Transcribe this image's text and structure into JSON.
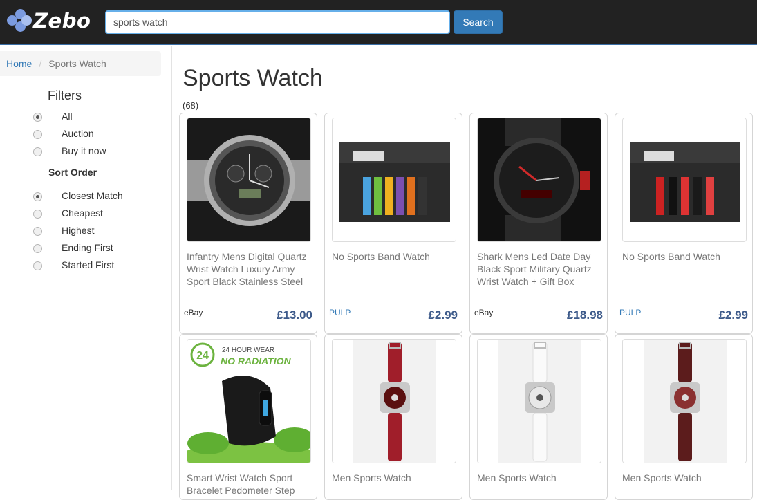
{
  "header": {
    "logo_text": "Zebo",
    "search_value": "sports watch",
    "search_button": "Search"
  },
  "breadcrumb": {
    "home": "Home",
    "separator": "/",
    "current": "Sports Watch"
  },
  "filters": {
    "title": "Filters",
    "options": [
      {
        "label": "All",
        "selected": true
      },
      {
        "label": "Auction",
        "selected": false
      },
      {
        "label": "Buy it now",
        "selected": false
      }
    ]
  },
  "sort": {
    "title": "Sort Order",
    "options": [
      {
        "label": "Closest Match",
        "selected": true
      },
      {
        "label": "Cheapest",
        "selected": false
      },
      {
        "label": "Highest",
        "selected": false
      },
      {
        "label": "Ending First",
        "selected": false
      },
      {
        "label": "Started First",
        "selected": false
      }
    ]
  },
  "main": {
    "title": "Sports Watch",
    "count": "(68)"
  },
  "products": [
    {
      "title": "Infantry Mens Digital Quartz Wrist Watch Luxury Army Sport Black Stainless Steel",
      "source": "eBay",
      "price": "£13.00",
      "image": "metal-chronograph-watch-image"
    },
    {
      "title": "No Sports Band Watch",
      "source": "PULP",
      "price": "£2.99",
      "image": "sports-band-pack-image"
    },
    {
      "title": "Shark Mens Led Date Day Black Sport Military Quartz Wrist Watch + Gift Box",
      "source": "eBay",
      "price": "£18.98",
      "image": "black-military-watch-image"
    },
    {
      "title": "No Sports Band Watch",
      "source": "PULP",
      "price": "£2.99",
      "image": "sports-band-pack-image"
    },
    {
      "title": "Smart Wrist Watch Sport Bracelet Pedometer Step",
      "source": "",
      "price": "",
      "image": "smart-band-image",
      "banner_top": "24 HOUR WEAR",
      "banner_main": "NO RADIATION",
      "banner_num": "24"
    },
    {
      "title": "Men Sports Watch",
      "source": "",
      "price": "",
      "image": "red-strap-watch-image"
    },
    {
      "title": "Men Sports Watch",
      "source": "",
      "price": "",
      "image": "white-strap-watch-image"
    },
    {
      "title": "Men Sports Watch",
      "source": "",
      "price": "",
      "image": "brown-strap-watch-image"
    }
  ],
  "colors": {
    "header_bg": "#222222",
    "accent": "#337ab7",
    "price": "#3d5a8a"
  }
}
